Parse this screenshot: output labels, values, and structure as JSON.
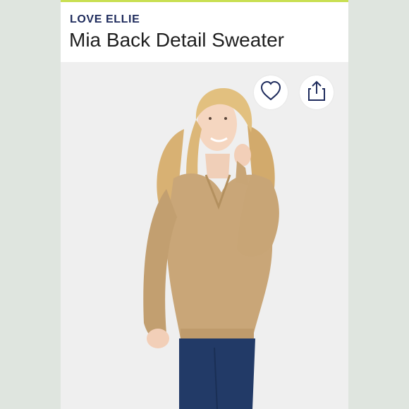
{
  "header": {
    "brand": "LOVE ELLIE",
    "title": "Mia Back Detail Sweater"
  },
  "actions": {
    "wishlist_icon": "heart-icon",
    "share_icon": "share-icon"
  },
  "colors": {
    "accent": "#c9df52",
    "brand_text": "#1e2b5c",
    "sweater": "#c9a678",
    "jeans": "#223a67"
  }
}
